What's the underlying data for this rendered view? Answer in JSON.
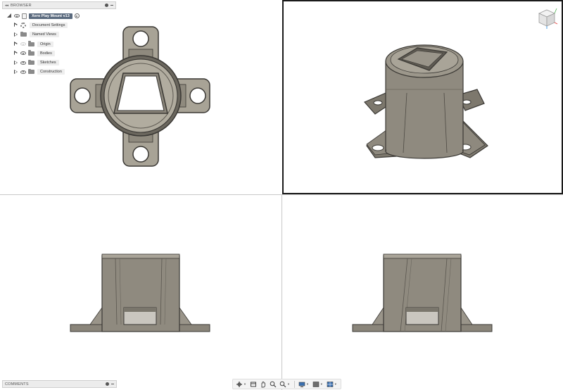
{
  "browser": {
    "header_title": "BROWSER",
    "root_label": "Xero Play Mount v13",
    "items": [
      {
        "label": "Document Settings",
        "icon": "gear-icon"
      },
      {
        "label": "Named Views",
        "icon": "folder-icon"
      },
      {
        "label": "Origin",
        "icon": "folder-icon"
      },
      {
        "label": "Bodies",
        "icon": "folder-icon"
      },
      {
        "label": "Sketches",
        "icon": "folder-icon"
      },
      {
        "label": "Construction",
        "icon": "folder-icon"
      }
    ]
  },
  "comments": {
    "header_title": "COMMENTS"
  },
  "toolbar": {
    "buttons": [
      "orbit-icon",
      "look-at-icon",
      "pan-icon",
      "zoom-fit-icon",
      "zoom-window-icon",
      "display-mode-icon",
      "grid-icon",
      "viewports-icon"
    ]
  },
  "colors": {
    "model_face": "#a8a396",
    "model_edge": "#3a3834",
    "model_dark": "#6b675e",
    "active_outline": "#1a1a1a",
    "selected_root": "#5a6a7e"
  }
}
